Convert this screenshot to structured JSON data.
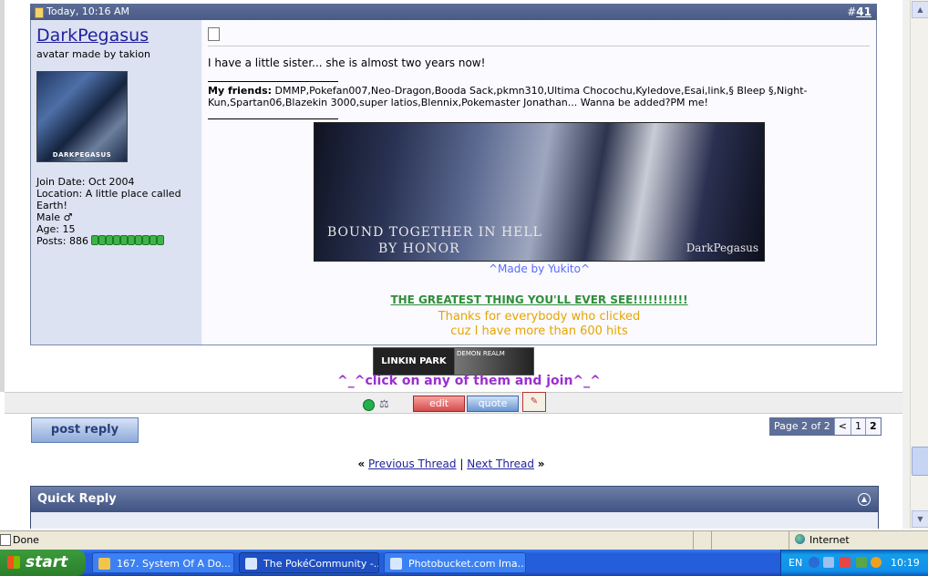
{
  "post": {
    "date": "Today, 10:16 AM",
    "number_prefix": "#",
    "number": "41",
    "username": "DarkPegasus",
    "user_title": "avatar made by takion",
    "avatar_caption": "DARKPEGASUS",
    "join_date": "Join Date: Oct 2004",
    "location": "Location: A little place called Earth!",
    "gender": "Male ♂",
    "age": "Age: 15",
    "posts": "Posts: 886",
    "reputation_pips": 10,
    "message": "I have a little sister... she is almost two years now!",
    "friends_label": "My friends:",
    "friends_text": "DMMP,Pokefan007,Neo-Dragon,Booda Sack,pkmn310,Ultima Chocochu,Kyledove,Esai,link,§ Bleep §,Night-Kun,Spartan06,Blazekin 3000,super latios,Blennix,Pokemaster Jonathan... Wanna be added?PM me!",
    "banner_line1": "BOUND TOGETHER IN HELL",
    "banner_line2": "BY HONOR",
    "banner_signature": "DarkPegasus",
    "made_by": "^Made by Yukito^",
    "greatest_link": "THE GREATEST THING YOU'LL EVER SEE!!!!!!!!!!!",
    "thanks_line1": "Thanks for everybody who clicked",
    "thanks_line2": "cuz I have more than 600 hits",
    "badge_linkin": "LINKIN PARK",
    "badge_demon": "DEMON REALM",
    "click_join": "^_^click on any of them and join^_^",
    "edit_label": "edit",
    "quote_label": "quote"
  },
  "actions": {
    "post_reply": "post reply"
  },
  "pagination": {
    "label": "Page 2 of 2",
    "prev": "<",
    "pages": [
      "1",
      "2"
    ],
    "current": "2"
  },
  "thread_nav": {
    "left_quote": "«",
    "previous": "Previous Thread",
    "separator": "|",
    "next": "Next Thread",
    "right_quote": "»"
  },
  "quick_reply": {
    "title": "Quick Reply"
  },
  "status_bar": {
    "text": "Done",
    "zone": "Internet"
  },
  "taskbar": {
    "start": "start",
    "tasks": [
      "167. System Of A Do...",
      "The PokéCommunity -...",
      "Photobucket.com Ima..."
    ],
    "language": "EN",
    "clock": "10:19"
  },
  "colors": {
    "header_blue": "#5d6f98",
    "link_blue": "#22229c",
    "post_green": "#2f8f3a",
    "thanks_orange": "#e6a400",
    "join_purple": "#9b2fd1"
  }
}
